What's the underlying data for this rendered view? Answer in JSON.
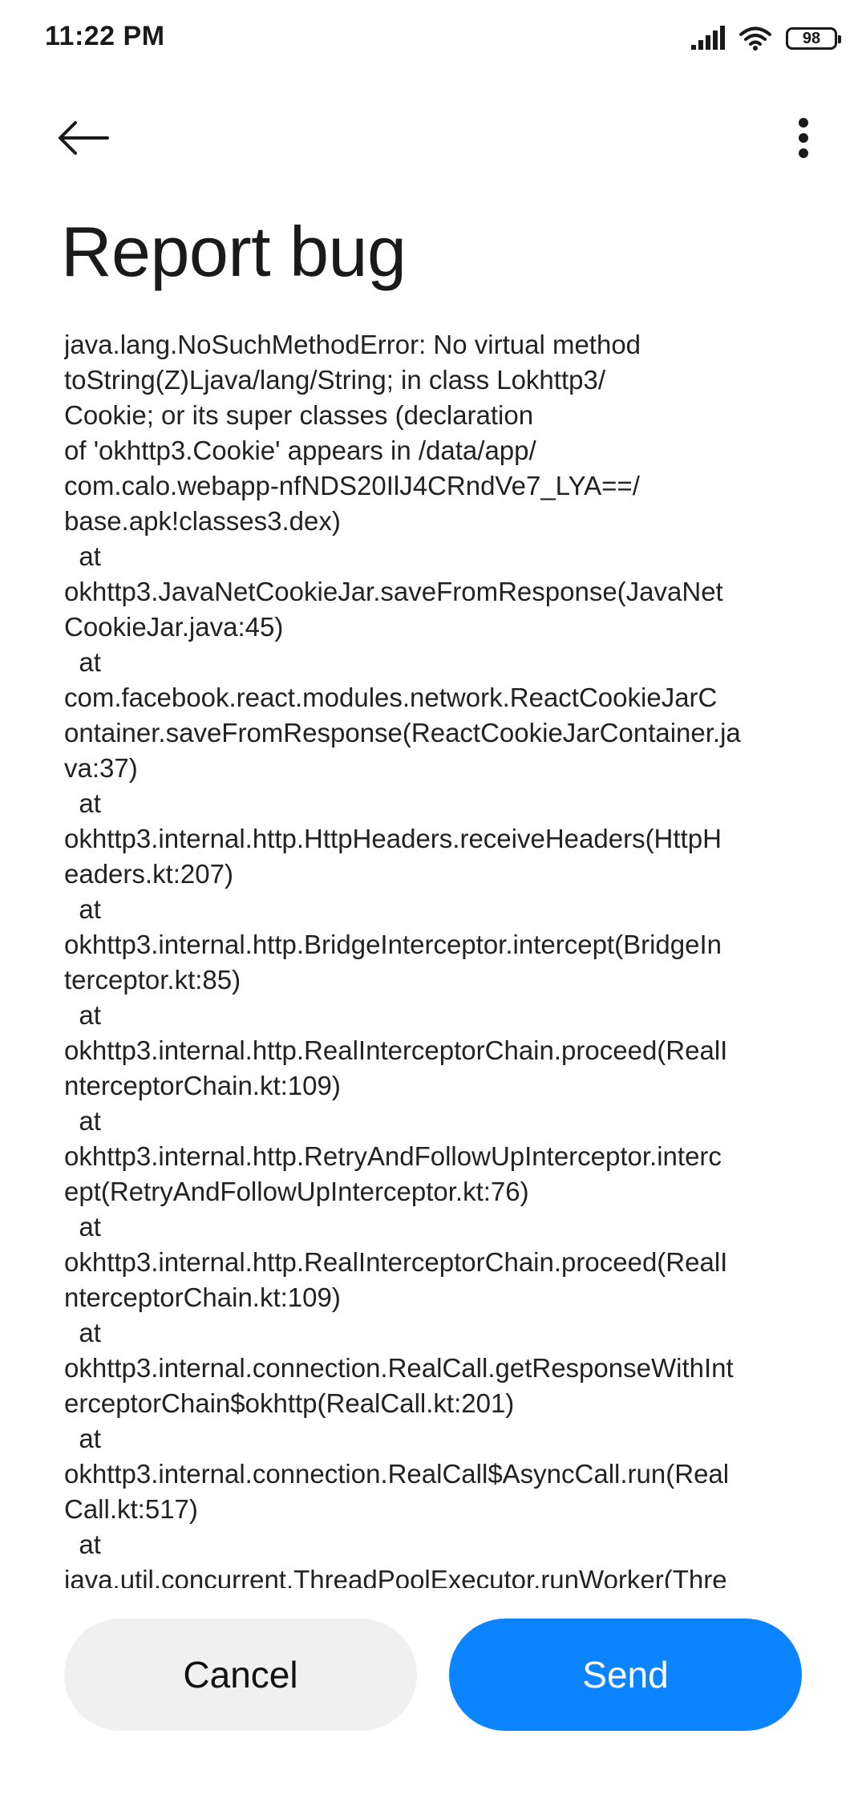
{
  "status_bar": {
    "time": "11:22 PM",
    "battery_level": "98",
    "icons": [
      "signal-icon",
      "wifi-icon",
      "battery-icon"
    ]
  },
  "app_bar": {
    "back_icon": "arrow-left-icon",
    "menu_icon": "more-vertical-icon"
  },
  "page": {
    "title": "Report bug"
  },
  "log": {
    "text": "java.lang.NoSuchMethodError: No virtual method\ntoString(Z)Ljava/lang/String; in class Lokhttp3/\nCookie; or its super classes (declaration\nof 'okhttp3.Cookie' appears in /data/app/\ncom.calo.webapp-nfNDS20IlJ4CRndVe7_LYA==/\nbase.apk!classes3.dex)\n  at\nokhttp3.JavaNetCookieJar.saveFromResponse(JavaNet\nCookieJar.java:45)\n  at\ncom.facebook.react.modules.network.ReactCookieJarC\nontainer.saveFromResponse(ReactCookieJarContainer.ja\nva:37)\n  at\nokhttp3.internal.http.HttpHeaders.receiveHeaders(HttpH\neaders.kt:207)\n  at\nokhttp3.internal.http.BridgeInterceptor.intercept(BridgeIn\nterceptor.kt:85)\n  at\nokhttp3.internal.http.RealInterceptorChain.proceed(RealI\nnterceptorChain.kt:109)\n  at\nokhttp3.internal.http.RetryAndFollowUpInterceptor.interc\nept(RetryAndFollowUpInterceptor.kt:76)\n  at\nokhttp3.internal.http.RealInterceptorChain.proceed(RealI\nnterceptorChain.kt:109)\n  at\nokhttp3.internal.connection.RealCall.getResponseWithInt\nerceptorChain$okhttp(RealCall.kt:201)\n  at\nokhttp3.internal.connection.RealCall$AsyncCall.run(Real\nCall.kt:517)\n  at\njava.util.concurrent.ThreadPoolExecutor.runWorker(Thre"
  },
  "actions": {
    "cancel_label": "Cancel",
    "send_label": "Send"
  },
  "colors": {
    "primary": "#0d84ff",
    "secondary_button_bg": "#f0f0f0",
    "text": "#1a1a1a"
  }
}
